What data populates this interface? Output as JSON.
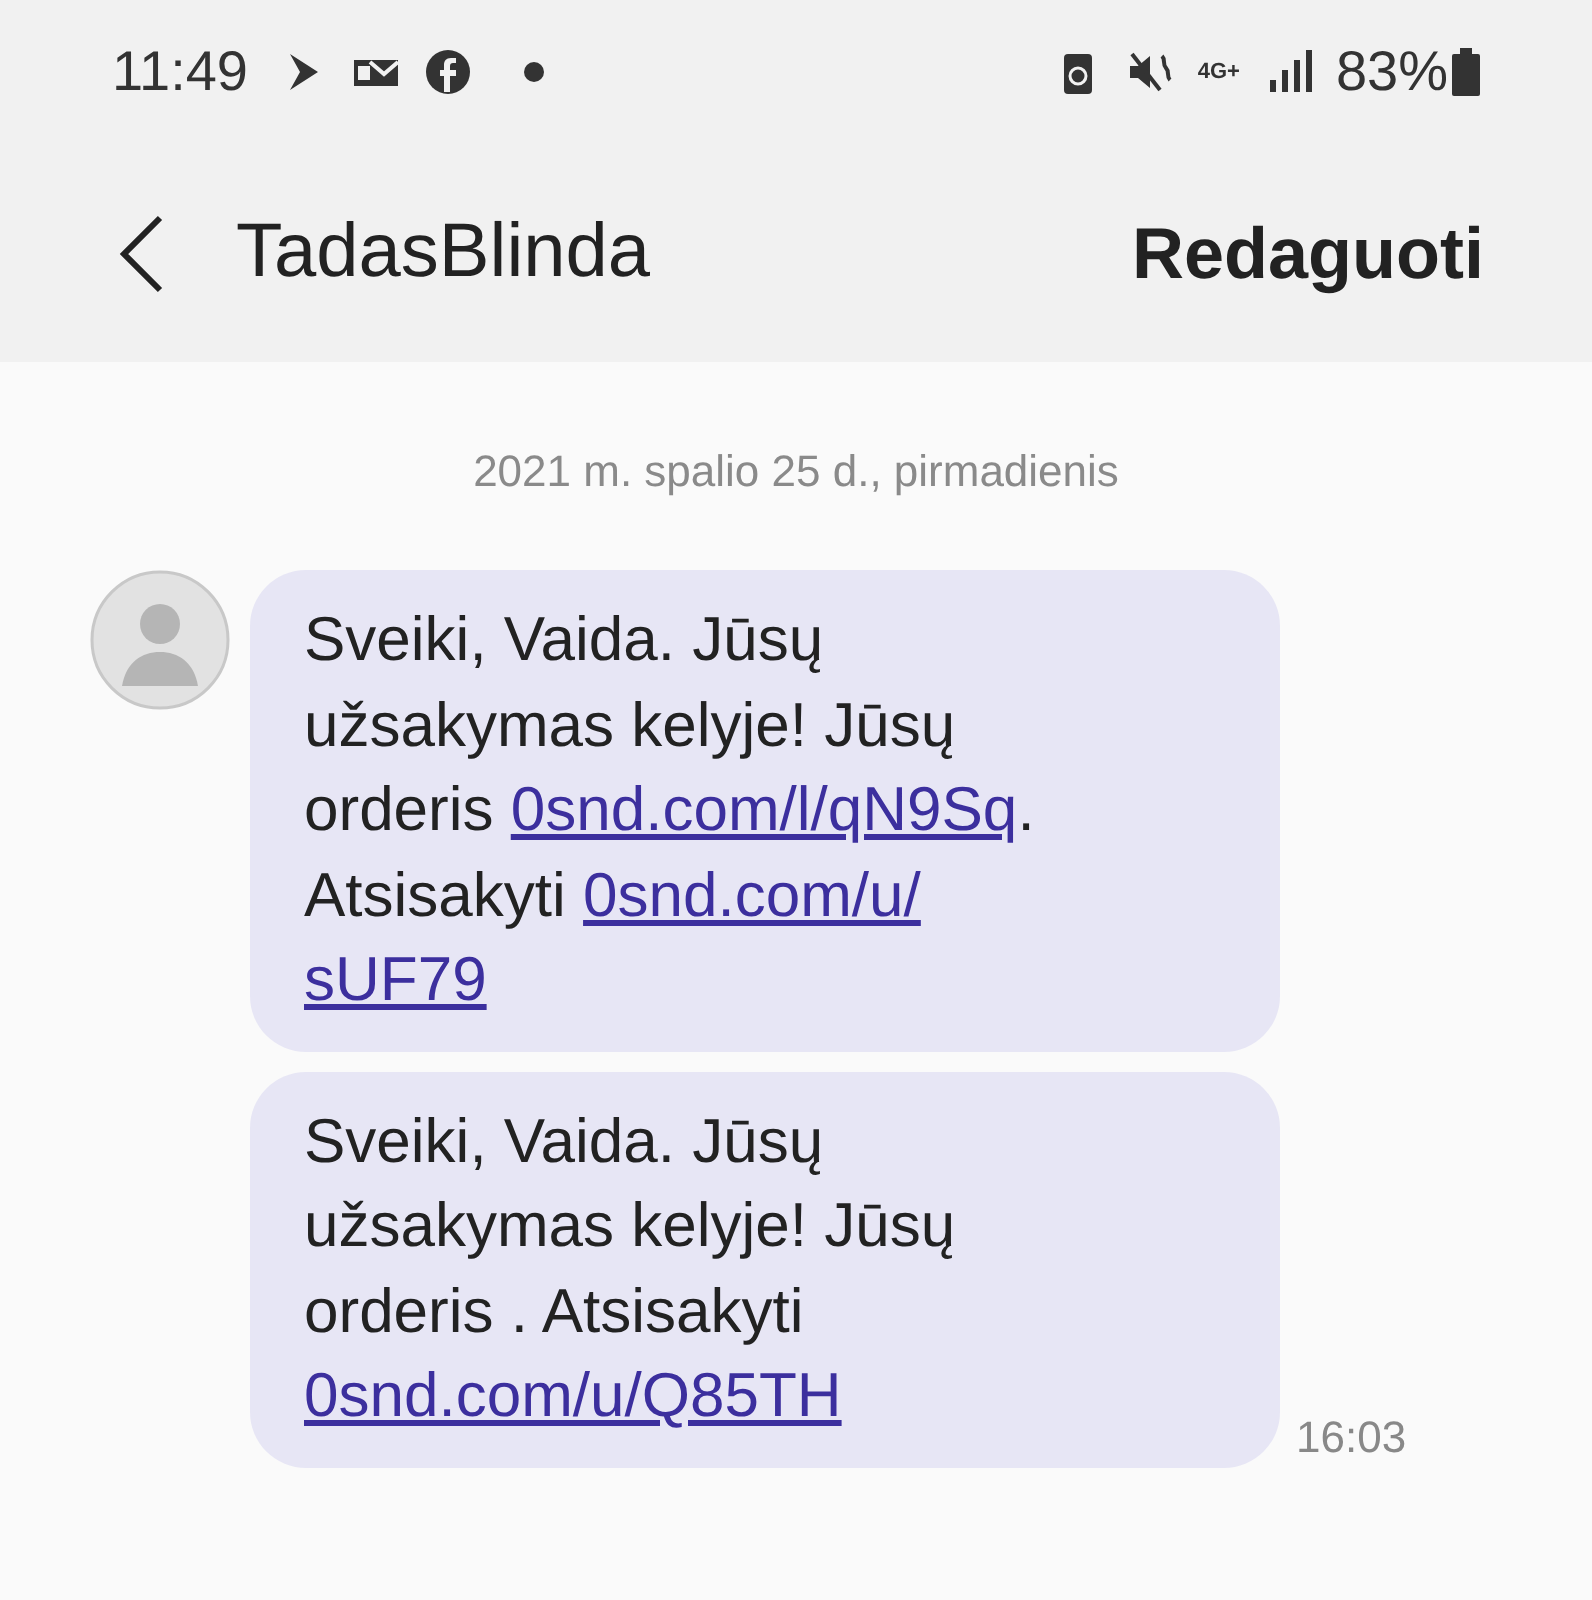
{
  "status_bar": {
    "time": "11:49",
    "network": "4G+",
    "battery": "83%"
  },
  "header": {
    "title": "TadasBlinda",
    "action": "Redaguoti"
  },
  "date_separator": "2021 m. spalio 25 d., pirmadienis",
  "messages": [
    {
      "lines": [
        [
          {
            "kind": "text",
            "text": "Sveiki, Vaida. Jūsų"
          }
        ],
        [
          {
            "kind": "text",
            "text": "užsakymas kelyje! Jūsų"
          }
        ],
        [
          {
            "kind": "text",
            "text": "orderis "
          },
          {
            "kind": "link",
            "text": "0snd.com/l/qN9Sq"
          },
          {
            "kind": "text",
            "text": "."
          }
        ],
        [
          {
            "kind": "text",
            "text": "Atsisakyti "
          },
          {
            "kind": "link",
            "text": "0snd.com/u/"
          }
        ],
        [
          {
            "kind": "link",
            "text": "sUF79"
          }
        ]
      ]
    },
    {
      "lines": [
        [
          {
            "kind": "text",
            "text": "Sveiki, Vaida. Jūsų"
          }
        ],
        [
          {
            "kind": "text",
            "text": "užsakymas kelyje! Jūsų"
          }
        ],
        [
          {
            "kind": "text",
            "text": "orderis . Atsisakyti"
          }
        ],
        [
          {
            "kind": "link",
            "text": "0snd.com/u/Q85TH"
          }
        ]
      ],
      "time": "16:03"
    }
  ]
}
